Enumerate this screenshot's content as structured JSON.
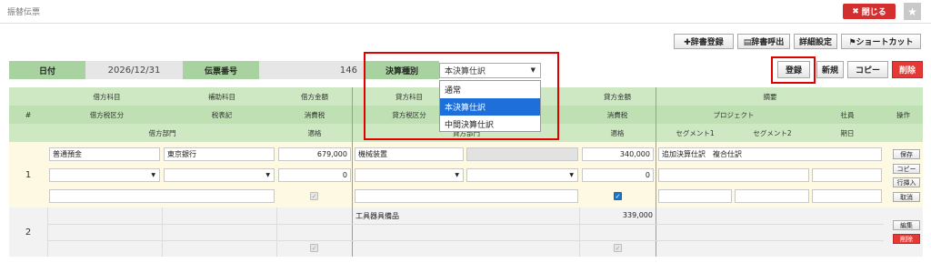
{
  "page": {
    "title": "振替伝票"
  },
  "window": {
    "close_label": "閉じる",
    "close_icon": "✖",
    "star_icon": "★"
  },
  "toolbar": {
    "dict_register": "✚辞書登録",
    "dict_call": "▤辞書呼出",
    "detail_settings": "詳細設定",
    "shortcut": "⚑ショートカット"
  },
  "header": {
    "date_label": "日付",
    "date_value": "2026/12/31",
    "slip_no_label": "伝票番号",
    "slip_no_value": "146",
    "settle_type_label": "決算種別",
    "settle_type_value": "本決算仕訳",
    "settle_type_options": [
      "通常",
      "本決算仕訳",
      "中間決算仕訳"
    ]
  },
  "actions": {
    "register": "登録",
    "new": "新規",
    "copy": "コピー",
    "delete": "削除"
  },
  "columns": {
    "num": "#",
    "debit_account": "借方科目",
    "sub_account": "補助科目",
    "debit_amount": "借方金額",
    "debit_tax_class": "借方税区分",
    "tax_note": "税表記",
    "consumption_tax": "消費税",
    "debit_dept": "借方部門",
    "proper": "適格",
    "credit_account": "貸方科目",
    "credit_amount": "貸方金額",
    "credit_tax_class": "貸方税区分",
    "credit_dept": "貸方部門",
    "description": "摘要",
    "project": "プロジェクト",
    "employee": "社員",
    "segment1": "セグメント1",
    "segment2": "セグメント2",
    "due_date": "期日",
    "operation": "操作"
  },
  "rows": [
    {
      "num": "1",
      "debit_account": "普通預金",
      "sub_account": "東京銀行",
      "debit_amount": "679,000",
      "debit_tax": "0",
      "credit_account": "機械装置",
      "credit_amount": "340,000",
      "credit_tax": "0",
      "description": "追加決算仕訳　複合仕訳",
      "buttons": [
        "保存",
        "コピー",
        "行挿入",
        "取消"
      ]
    },
    {
      "num": "2",
      "credit_account": "工具器具備品",
      "credit_amount": "339,000",
      "buttons": [
        "編集",
        "削除"
      ]
    }
  ]
}
